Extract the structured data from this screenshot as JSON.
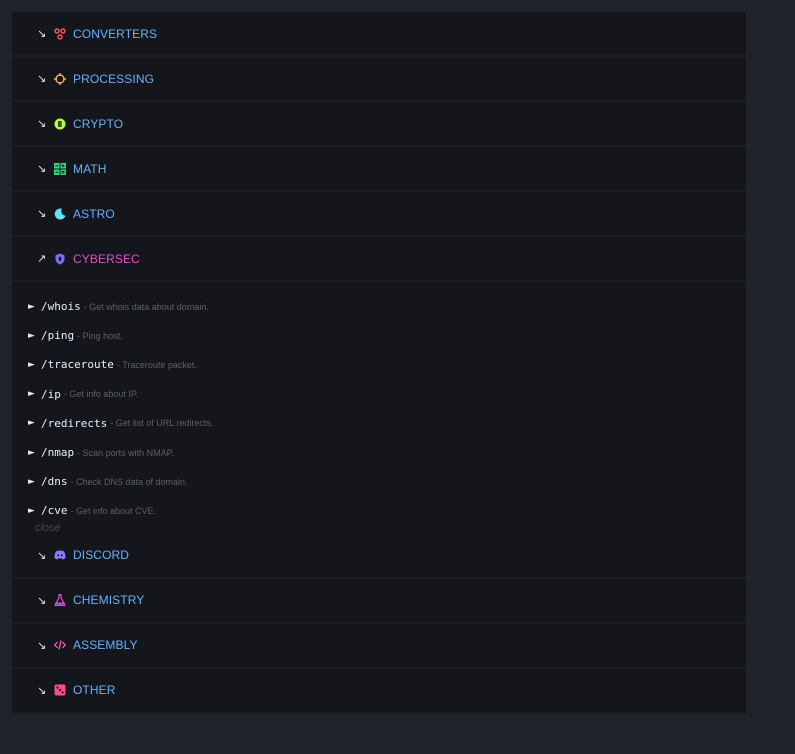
{
  "sections_top": [
    {
      "label": "CONVERTERS",
      "arrow": "↘",
      "icon": "converters-icon",
      "color": "#ff5a5a"
    },
    {
      "label": "PROCESSING",
      "arrow": "↘",
      "icon": "processing-icon",
      "color": "#ffa94d"
    },
    {
      "label": "CRYPTO",
      "arrow": "↘",
      "icon": "crypto-icon",
      "color": "#b4ff39"
    },
    {
      "label": "MATH",
      "arrow": "↘",
      "icon": "math-icon",
      "color": "#37d67a"
    },
    {
      "label": "ASTRO",
      "arrow": "↘",
      "icon": "astro-icon",
      "color": "#5ce5ff"
    },
    {
      "label": "CYBERSEC",
      "arrow": "↗",
      "icon": "cybersec-icon",
      "color": "#7a6bff"
    }
  ],
  "cybersec_commands": [
    {
      "name": "/whois",
      "desc": "- Get whois data about domain."
    },
    {
      "name": "/ping",
      "desc": "- Ping host."
    },
    {
      "name": "/traceroute",
      "desc": "- Traceroute packet."
    },
    {
      "name": "/ip",
      "desc": "- Get info about IP."
    },
    {
      "name": "/redirects",
      "desc": "- Get list of URL redirects."
    },
    {
      "name": "/nmap",
      "desc": "- Scan ports with NMAP."
    },
    {
      "name": "/dns",
      "desc": "- Check DNS data of domain."
    },
    {
      "name": "/cve",
      "desc": "- Get info about CVE."
    }
  ],
  "close_label": "close",
  "command_marker": "►",
  "sections_bottom": [
    {
      "label": "DISCORD",
      "arrow": "↘",
      "icon": "discord-icon",
      "color": "#8c7dff"
    },
    {
      "label": "CHEMISTRY",
      "arrow": "↘",
      "icon": "chemistry-icon",
      "color": "#e24fd5"
    },
    {
      "label": "ASSEMBLY",
      "arrow": "↘",
      "icon": "assembly-icon",
      "color": "#ff5ab4"
    },
    {
      "label": "OTHER",
      "arrow": "↘",
      "icon": "other-icon",
      "color": "#ff4d88"
    }
  ]
}
